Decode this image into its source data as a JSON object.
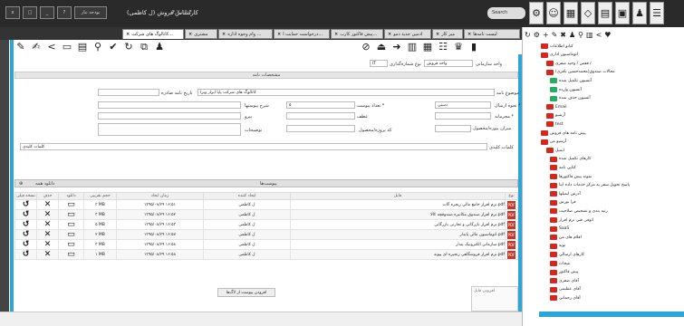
{
  "topbar": {
    "title": "کارشناس فروش (ل کاظمی)",
    "version": "۴.۷.۱۶.۴",
    "buttons": [
      "x",
      "□",
      "_",
      "?",
      "بودجه تبار"
    ],
    "search": "Search"
  },
  "tabs": [
    {
      "label": "کاتالوگ های شرکت...",
      "active": true
    },
    {
      "label": "مشتری",
      "active": false
    },
    {
      "label": "وام وجوه اداره ...",
      "active": false
    },
    {
      "label": "درخواست حمایت ا...",
      "active": false
    },
    {
      "label": "پیش فاکتور کارب...",
      "active": false
    },
    {
      "label": "ادمین جدید دمو",
      "active": false
    },
    {
      "label": "میز کار",
      "active": false
    },
    {
      "label": "لیست نامه‌ها",
      "active": false
    }
  ],
  "form": {
    "unit_label": "واحد سازمانی",
    "unit_value": "واحد فروش",
    "type_label": "نوع شماره‌گذاری",
    "type_value": "IT",
    "section": "مشخصات نامه",
    "subject_label": "موضوع نامه",
    "subject_value": "کاتالوگ های شرکت پایا ابزار ویرا",
    "send_label": "نحوه ارسال *",
    "send_value": "دستی",
    "attach_count_label": "تعداد پیوست *",
    "attach_count_value": "۵",
    "issue_date_label": "تاریخ نامه صادره",
    "secret_label": "محرمانه *",
    "related_label": "عطف",
    "desc_short_label": "شرح پیوستها",
    "follow_label": "پیرو",
    "attach_amount_label": "میزان پیوزه/محصول",
    "code_label": "کد پروژه/محصول",
    "notes_label": "توضیحات",
    "keywords_label": "کلمات کلیدی",
    "keywords_value": "کلمات کلیدی"
  },
  "attachments": {
    "title": "پیوست‌ها",
    "download_all": "دانلود همه",
    "headers": [
      "نوع",
      "فایل",
      "ایجاد کننده",
      "زمان ایجاد",
      "حجم تقریبی",
      "دانلود",
      "حذف",
      "نسخه قبلی"
    ],
    "rows": [
      {
        "file": "نرم افزار جامع مالی ربجره گات.pdf",
        "creator": "ل کاظمی",
        "date": "۱۳۹۵/۰۸/۲۹ ۱۶:۵۱",
        "size": "۳ MB"
      },
      {
        "file": "نرم افزار صندوق مکانیزه صندوقچه کالا.pdf",
        "creator": "ل کاظمی",
        "date": "۱۳۹۵/۰۸/۲۹ ۱۶:۵۲",
        "size": "۳ MB"
      },
      {
        "file": "نرم افزار بازرگانی و تجارتی بازرگانی.pdf",
        "creator": "ل کاظمی",
        "date": "۱۳۹۵/۰۸/۲۹ ۱۶:۵۳",
        "size": "۵ MB"
      },
      {
        "file": "اتوماسیون مالی پایدار.pdf",
        "creator": "ل کاظمی",
        "date": "۱۳۹۵/۰۸/۲۹ ۱۶:۵۷",
        "size": "۲ MB"
      },
      {
        "file": "سازمانی الکترونیک پندار.pdf",
        "creator": "ل کاظمی",
        "date": "۱۳۹۵/۰۸/۲۹ ۱۶:۵۸",
        "size": "۳ MB"
      },
      {
        "file": "نرم افزار فروشگاهی زنجیره ای پیوند.pdf",
        "creator": "ل کاظمی",
        "date": "۱۳۹۵/۰۸/۲۹ ۱۶:۵۸",
        "size": "۱ MB"
      }
    ],
    "notes_placeholder": "افزودن فایل",
    "add_button": "افزودن پیوست از لاگ‌ها"
  },
  "tree": [
    {
      "label": "کیانو اطلاعات",
      "color": "r"
    },
    {
      "label": "اتوماسیون اداری",
      "color": "r"
    },
    {
      "label": "قفس / وحید صفری /",
      "color": "r"
    },
    {
      "label": "محالات صندوق(محمدحسین باقری)",
      "color": "r"
    },
    {
      "label": "آتسیون تکمیل شده",
      "color": "g"
    },
    {
      "label": "آتسیون وارده",
      "color": "g"
    },
    {
      "label": "آتسیون حذف شده",
      "color": "g"
    },
    {
      "label": "Email",
      "color": "r"
    },
    {
      "label": "آرشیو",
      "color": "r"
    },
    {
      "label": "test",
      "color": "r"
    },
    {
      "label": "پیش نامه های فروش",
      "color": "r"
    },
    {
      "label": "آرشیو من",
      "color": "r"
    },
    {
      "label": "ایمیل",
      "color": "r"
    },
    {
      "label": "کارهای تکمیل شده",
      "color": "r"
    },
    {
      "label": "کتابی نامه",
      "color": "r"
    },
    {
      "label": "نمونه پیش فاکتورها",
      "color": "r"
    },
    {
      "label": "پاسخ تحویل سفر به مرکز خدمات داده اینا",
      "color": "r"
    },
    {
      "label": "آدرس ایمیلها",
      "color": "r"
    },
    {
      "label": "فرا بورس",
      "color": "r"
    },
    {
      "label": "رتبه بندی و تشخیص صلاحیت",
      "color": "r"
    },
    {
      "label": "اتوفی فنی نرم افزار",
      "color": "r"
    },
    {
      "label": "SaaS",
      "color": "r"
    },
    {
      "label": "اقلام های من",
      "color": "r"
    },
    {
      "label": "نوبه",
      "color": "r"
    },
    {
      "label": "کارهای ارسالی",
      "color": "r"
    },
    {
      "label": "نتیجات",
      "color": "r"
    },
    {
      "label": "پیش فاکتور",
      "color": "r"
    },
    {
      "label": "آقای صفری",
      "color": "r"
    },
    {
      "label": "آقای عظیمی",
      "color": "r"
    },
    {
      "label": "آقای رحمانی",
      "color": "r"
    }
  ]
}
